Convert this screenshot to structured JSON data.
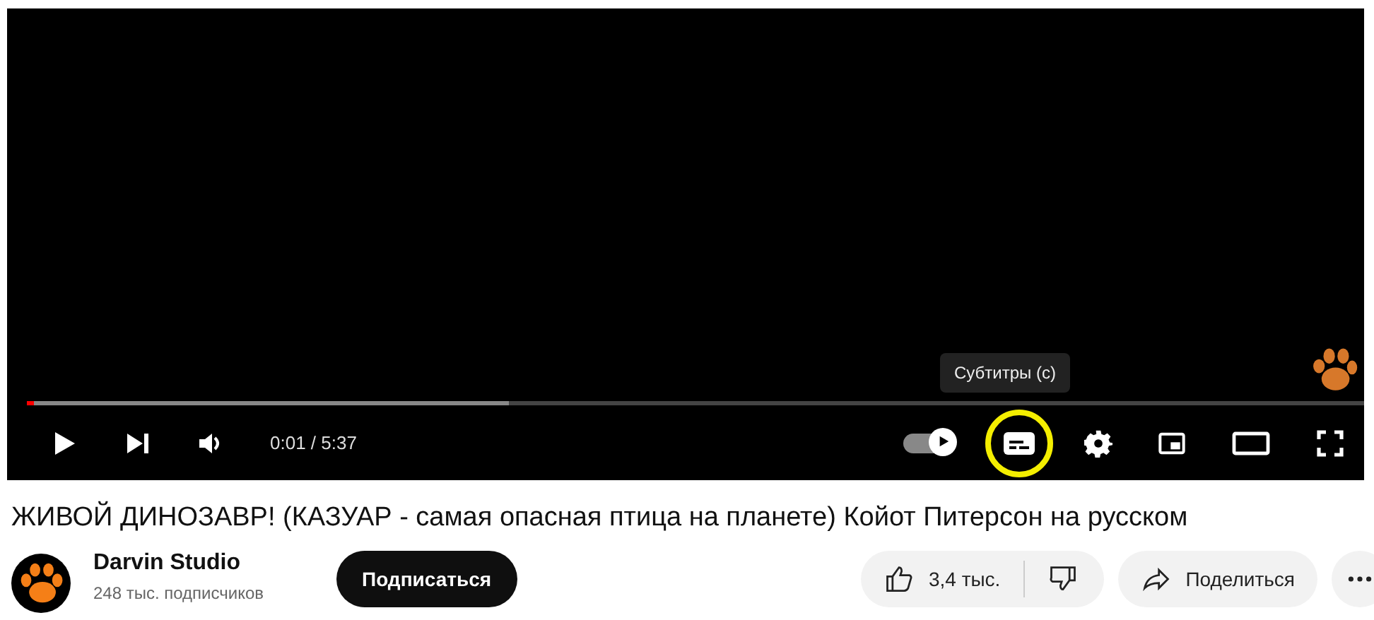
{
  "player": {
    "tooltip": "Субтитры (с)",
    "progress": {
      "level": 0.003
    },
    "buffer": {
      "level": 0.36
    },
    "time": "0:01 / 5:37",
    "autoplay": {
      "on": true
    },
    "subtitles": {
      "highlighted": true
    }
  },
  "video": {
    "title": "ЖИВОЙ ДИНОЗАВР! (КАЗУАР - самая опасная птица на планете) Койот Питерсон на русском"
  },
  "channel": {
    "name": "Darvin Studio",
    "subscribers": "248 тыс. подписчиков",
    "subscribe": "Подписаться"
  },
  "actions": {
    "likes": "3,4 тыс.",
    "share": "Поделиться"
  }
}
